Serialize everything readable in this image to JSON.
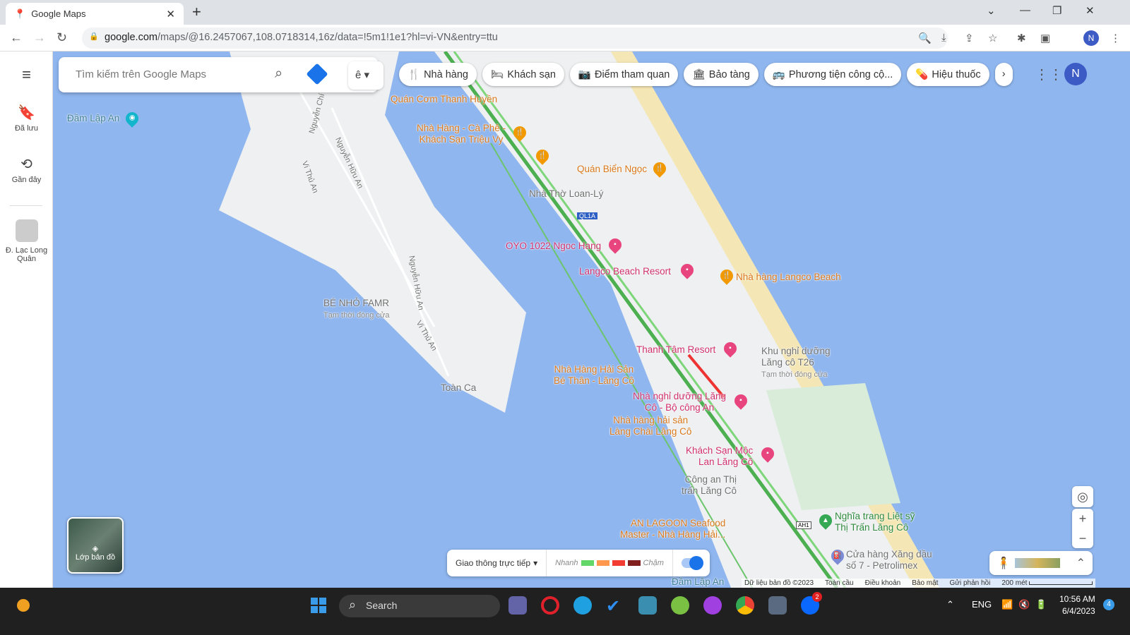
{
  "browser": {
    "tab_title": "Google Maps",
    "url_host": "google.com",
    "url_path": "/maps/@16.2457067,108.0718314,16z/data=!5m1!1e1?hl=vi-VN&entry=ttu",
    "profile_initial": "N"
  },
  "sidebar": {
    "items": [
      {
        "label": "Đã lưu",
        "icon": "bookmark-icon"
      },
      {
        "label": "Gần đây",
        "icon": "history-icon"
      },
      {
        "label": "Đ. Lạc Long Quân",
        "icon": "place-thumbnail"
      }
    ]
  },
  "search": {
    "placeholder": "Tìm kiếm trên Google Maps",
    "lang_button": "ê"
  },
  "chips": [
    {
      "icon": "🍴",
      "label": "Nhà hàng"
    },
    {
      "icon": "🛏",
      "label": "Khách sạn"
    },
    {
      "icon": "📷",
      "label": "Điểm tham quan"
    },
    {
      "icon": "🏛",
      "label": "Bảo tàng"
    },
    {
      "icon": "🚌",
      "label": "Phương tiện công cộ..."
    },
    {
      "icon": "💊",
      "label": "Hiệu thuốc"
    }
  ],
  "account_initial": "N",
  "map_labels": {
    "dam_lap_an": "Đầm Lập An",
    "quan_com": "Quán Cơm Thanh Huyền",
    "nha_hang_ca_phe": "Nhà Hàng - Cà Phê -",
    "ks_trieu_vy": "Khách Sạn Triệu Vy",
    "quan_bien_ngoc": "Quán Biển Ngọc",
    "nha_tho": "Nhà Thờ Loan-Lý",
    "ql1a": "QL1A",
    "oyo": "OYO 1022 Ngoc Hang",
    "langco_beach_resort": "Langco Beach Resort",
    "nh_langco_beach": "Nhà hàng Langco Beach",
    "be_nho": "BÉ NHỎ FAMR",
    "be_nho_sub": "Tạm thời đóng cửa",
    "thanh_tam": "Thanh Tâm Resort",
    "khu_nghi_1": "Khu nghỉ dưỡng",
    "khu_nghi_2": "Lăng cô T26",
    "khu_nghi_sub": "Tạm thời đóng cửa",
    "nh_hai_san_1": "Nhà Hàng Hải Sản",
    "nh_hai_san_2": "Bé Thân - Lăng Cô",
    "toan_ca": "Toàn Ca",
    "nghi_duong_1": "Nhà nghỉ dưỡng Lăng",
    "nghi_duong_2": "Cô - Bộ công An",
    "lang_chai_1": "Nhà hàng hải sản",
    "lang_chai_2": "Làng Chài Lăng Cô",
    "moc_lan_1": "Khách Sạn Mộc",
    "moc_lan_2": "Lan Lăng Cô",
    "cong_an_1": "Công an Thị",
    "cong_an_2": "trấn Lăng Cô",
    "an_lagoon_1": "AN LAGOON Seafood",
    "an_lagoon_2": "Master - Nhà Hàng Hải...",
    "nghia_trang_1": "Nghĩa trang Liệt sỹ",
    "nghia_trang_2": "Thị Trấn Lăng Cô",
    "xang_dau_1": "Cửa hàng Xăng dầu",
    "xang_dau_2": "số 7 - Petrolimex",
    "dam_lap_an_bottom": "Đầm Lập An",
    "ah1": "AH1",
    "roads": [
      "Nguyễn Chí",
      "Nguyễn Hữu An",
      "Vi Thủ An",
      "Nguyễn Hữu An",
      "Vi Thủ An"
    ]
  },
  "layers": {
    "label": "Lớp bản đồ"
  },
  "traffic": {
    "label": "Giao thông trực tiếp",
    "fast": "Nhanh",
    "slow": "Chậm",
    "colors": [
      "#63d668",
      "#ff974d",
      "#f23c32",
      "#811f1f"
    ],
    "enabled": true
  },
  "footer": {
    "data": "Dữ liệu bản đồ ©2023",
    "global": "Toàn cầu",
    "terms": "Điều khoản",
    "privacy": "Bảo mật",
    "feedback": "Gửi phản hồi",
    "scale": "200 mét"
  },
  "taskbar": {
    "search": "Search",
    "lang": "ENG",
    "time": "10:56 AM",
    "date": "6/4/2023",
    "zalo_badge": "2",
    "notif": "4"
  }
}
